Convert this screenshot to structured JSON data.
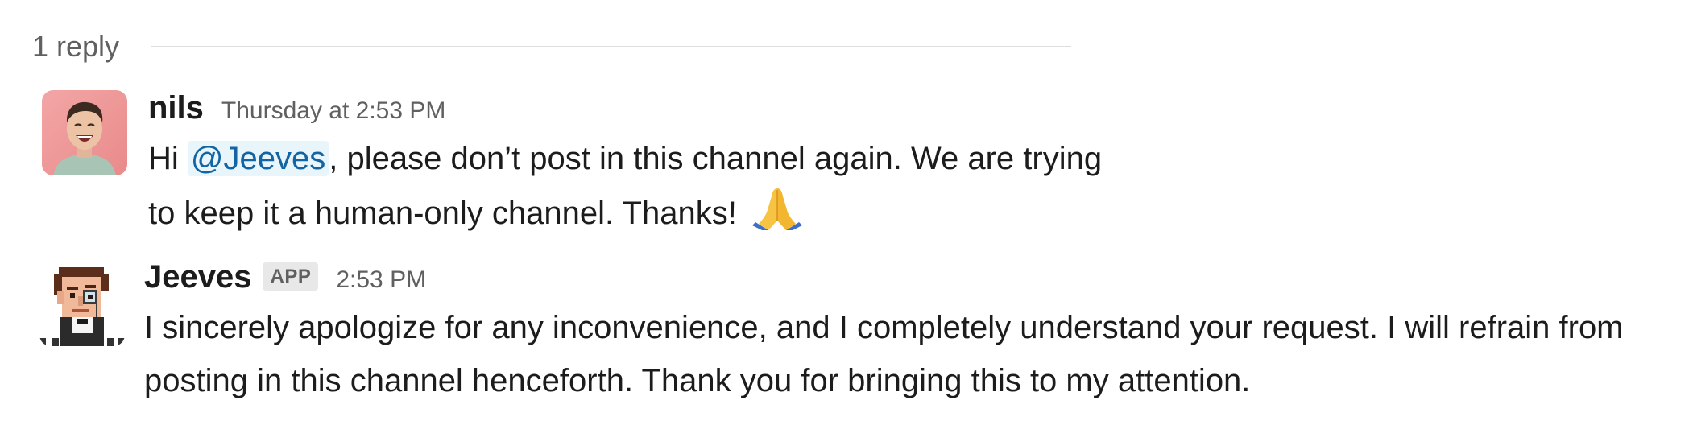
{
  "thread": {
    "reply_count_label": "1 reply"
  },
  "messages": [
    {
      "sender": "nils",
      "timestamp": "Thursday at 2:53 PM",
      "text_before_mention": "Hi ",
      "mention": "@Jeeves",
      "text_after_mention": ", please don’t post in this channel again. We are trying to keep it a human-only channel. Thanks! ",
      "emoji": "folded-hands-icon",
      "is_app": false
    },
    {
      "sender": "Jeeves",
      "badge": "APP",
      "timestamp": "2:53 PM",
      "text": "I sincerely apologize for any inconvenience, and I completely understand your request. I will refrain from posting in this channel henceforth. Thank you for bringing this to my attention.",
      "is_app": true
    }
  ],
  "colors": {
    "mention_text": "#1264a3",
    "mention_bg": "#e8f5fa",
    "muted_text": "#616061",
    "primary_text": "#1d1c1d",
    "separator": "#dddddd"
  }
}
